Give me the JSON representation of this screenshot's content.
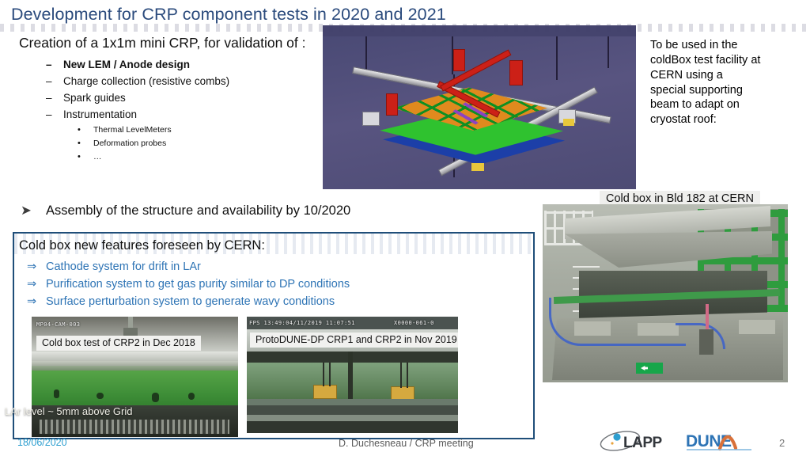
{
  "slide": {
    "title": "Development for CRP component tests in 2020 and 2021",
    "page_number": "2",
    "accent_color": "#2a4a7c",
    "box_border_color": "#1f4e79",
    "feature_text_color": "#2e74b5"
  },
  "intro": {
    "lead": "Creation of a 1x1m mini CRP, for validation of :",
    "items": [
      {
        "marker": "–",
        "label": "New LEM / Anode design",
        "bold": true
      },
      {
        "marker": "–",
        "label": "Charge collection (resistive combs)",
        "bold": false
      },
      {
        "marker": "–",
        "label": "Spark guides",
        "bold": false
      },
      {
        "marker": "–",
        "label": "Instrumentation",
        "bold": false
      }
    ],
    "subitems": [
      {
        "marker": "•",
        "label": "Thermal LevelMeters"
      },
      {
        "marker": "•",
        "label": "Deformation probes"
      },
      {
        "marker": "•",
        "label": "…"
      }
    ]
  },
  "right_note": {
    "text": "To be used in the coldBox test facility at CERN using a special supporting beam to adapt on cryostat roof:"
  },
  "assembly": {
    "marker": "➤",
    "text": "Assembly of the structure and availability by 10/2020"
  },
  "coldbox": {
    "caption": "Cold box in Bld 182 at CERN"
  },
  "features": {
    "heading": "Cold box new features foreseen by CERN:",
    "items": [
      {
        "marker": "⇒",
        "label": "Cathode system for drift in LAr"
      },
      {
        "marker": "⇒",
        "label": "Purification system to get gas purity similar to DP conditions"
      },
      {
        "marker": "⇒",
        "label": "Surface perturbation system to generate wavy conditions"
      }
    ]
  },
  "photos": {
    "crp2": {
      "cam_label": "MP04-CAM-003",
      "caption": "Cold box test of CRP2 in Dec 2018",
      "overlay_note": "LAr level ~ 5mm above Grid"
    },
    "crp1crp2": {
      "cam_label_left": "FPS 13:49:04/11/2019 11:07:51",
      "cam_label_right": "X0000-061-0",
      "caption": "ProtoDUNE-DP CRP1 and CRP2 in Nov 2019"
    }
  },
  "footer": {
    "date": "18/06/2020",
    "center": "D. Duchesneau / CRP meeting",
    "logo_lapp": "LAPP",
    "logo_dune": "DUNE"
  }
}
